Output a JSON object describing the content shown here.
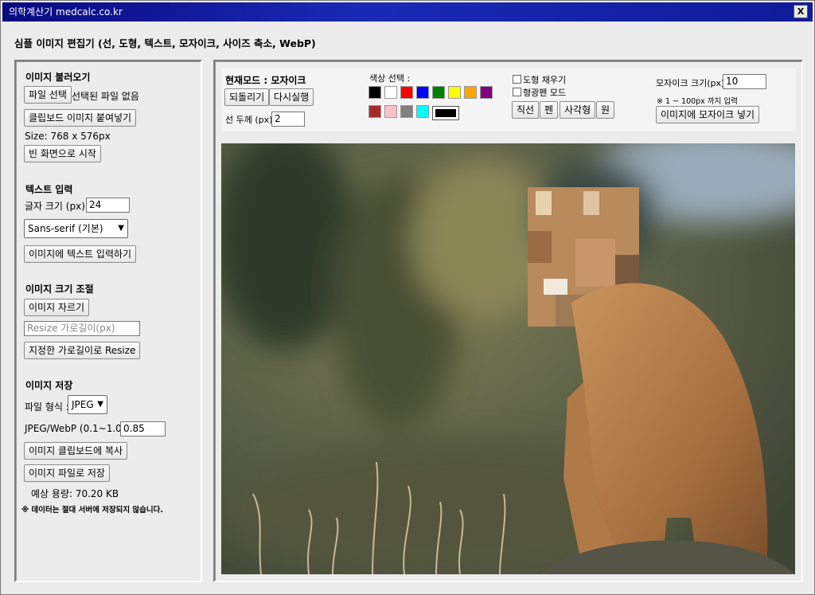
{
  "window": {
    "title": "의학계산기 medcalc.co.kr",
    "close_label": "X"
  },
  "page": {
    "title": "심플 이미지 편집기 (선, 도형, 텍스트, 모자이크, 사이즈 축소, WebP)"
  },
  "load": {
    "heading": "이미지 불러오기",
    "file_button": "파일 선택",
    "file_status": "선택된 파일 없음",
    "paste_button": "클립보드 이미지 붙여넣기",
    "size_text": "Size: 768 x 576px",
    "blank_button": "빈 화면으로 시작"
  },
  "text_input": {
    "heading": "텍스트 입력",
    "font_size_label": "글자 크기 (px) :",
    "font_size_value": "24",
    "font_family_value": "Sans-serif (기본)",
    "insert_button": "이미지에 텍스트 입력하기"
  },
  "resize": {
    "heading": "이미지 크기 조절",
    "crop_button": "이미지 자르기",
    "width_placeholder": "Resize 가로길이(px)",
    "resize_button": "지정한 가로길이로 Resize"
  },
  "save": {
    "heading": "이미지 저장",
    "format_label": "파일 형식 :",
    "format_value": "JPEG",
    "quality_label": "JPEG/WebP (0.1~1.0) :",
    "quality_value": "0.85",
    "copy_button": "이미지 클립보드에 복사",
    "save_button": "이미지 파일로 저장",
    "estimated_size": "예상 용량: 70.20 KB",
    "notice": "※ 데이터는 절대 서버에 저장되지 않습니다."
  },
  "toolbar": {
    "mode_label": "현재모드 : 모자이크",
    "undo_button": "되돌리기",
    "redo_button": "다시실행",
    "stroke_label": "선 두께 (px) :",
    "stroke_value": "2",
    "color_label": "색상 선택 :",
    "colors": [
      "#000000",
      "#ffffff",
      "#ff0000",
      "#0000ff",
      "#008000",
      "#ffff00",
      "#ffa500",
      "#800080",
      "#a52a2a",
      "#ffc0cb",
      "#808080",
      "#00ffff"
    ],
    "current_color": "#000000",
    "fill_shape_label": "도형 채우기",
    "highlighter_label": "형광펜 모드",
    "line_button": "직선",
    "pen_button": "펜",
    "rect_button": "사각형",
    "circle_button": "원",
    "mosaic_size_label": "모자이크 크기(px) :",
    "mosaic_size_value": "10",
    "mosaic_hint": "※ 1 ~ 100px 까지 입력",
    "apply_mosaic_button": "이미지에 모자이크 넣기"
  }
}
